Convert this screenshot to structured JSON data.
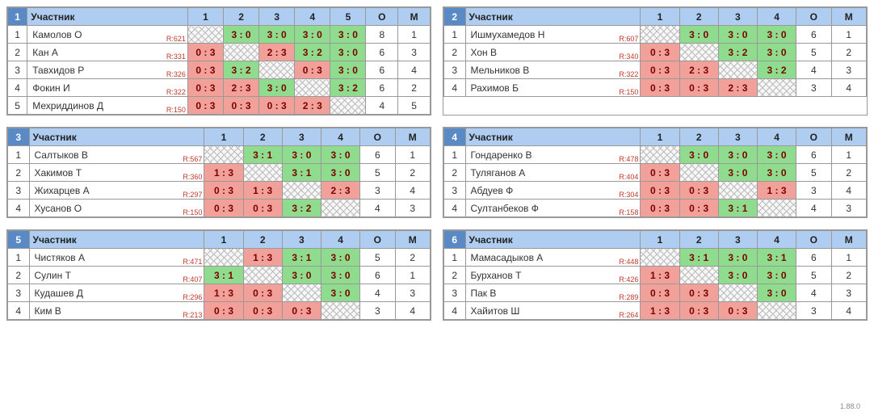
{
  "header_labels": {
    "participant": "Участник",
    "O": "О",
    "M": "М"
  },
  "version": "1.88.0",
  "chart_data": [
    {
      "group": 1,
      "rounds": 5,
      "players": [
        {
          "idx": 1,
          "name": "Камолов О",
          "rating": 621,
          "scores": [
            null,
            "3 : 0",
            "3 : 0",
            "3 : 0",
            "3 : 0"
          ],
          "results": [
            null,
            "win",
            "win",
            "win",
            "win"
          ],
          "O": 8,
          "M": 1
        },
        {
          "idx": 2,
          "name": "Кан А",
          "rating": 331,
          "scores": [
            "0 : 3",
            null,
            "2 : 3",
            "3 : 2",
            "3 : 0"
          ],
          "results": [
            "loss",
            null,
            "loss",
            "win",
            "win"
          ],
          "O": 6,
          "M": 3
        },
        {
          "idx": 3,
          "name": "Тавхидов Р",
          "rating": 326,
          "scores": [
            "0 : 3",
            "3 : 2",
            null,
            "0 : 3",
            "3 : 0"
          ],
          "results": [
            "loss",
            "win",
            null,
            "loss",
            "win"
          ],
          "O": 6,
          "M": 4
        },
        {
          "idx": 4,
          "name": "Фокин И",
          "rating": 322,
          "scores": [
            "0 : 3",
            "2 : 3",
            "3 : 0",
            null,
            "3 : 2"
          ],
          "results": [
            "loss",
            "loss",
            "win",
            null,
            "win"
          ],
          "O": 6,
          "M": 2
        },
        {
          "idx": 5,
          "name": "Мехриддинов Д",
          "rating": 150,
          "scores": [
            "0 : 3",
            "0 : 3",
            "0 : 3",
            "2 : 3",
            null
          ],
          "results": [
            "loss",
            "loss",
            "loss",
            "loss",
            null
          ],
          "O": 4,
          "M": 5
        }
      ]
    },
    {
      "group": 2,
      "rounds": 4,
      "players": [
        {
          "idx": 1,
          "name": "Ишмухамедов Н",
          "rating": 607,
          "scores": [
            null,
            "3 : 0",
            "3 : 0",
            "3 : 0"
          ],
          "results": [
            null,
            "win",
            "win",
            "win"
          ],
          "O": 6,
          "M": 1
        },
        {
          "idx": 2,
          "name": "Хон В",
          "rating": 340,
          "scores": [
            "0 : 3",
            null,
            "3 : 2",
            "3 : 0"
          ],
          "results": [
            "loss",
            null,
            "win",
            "win"
          ],
          "O": 5,
          "M": 2
        },
        {
          "idx": 3,
          "name": "Мельников В",
          "rating": 322,
          "scores": [
            "0 : 3",
            "2 : 3",
            null,
            "3 : 2"
          ],
          "results": [
            "loss",
            "loss",
            null,
            "win"
          ],
          "O": 4,
          "M": 3
        },
        {
          "idx": 4,
          "name": "Рахимов Б",
          "rating": 150,
          "scores": [
            "0 : 3",
            "0 : 3",
            "2 : 3",
            null
          ],
          "results": [
            "loss",
            "loss",
            "loss",
            null
          ],
          "O": 3,
          "M": 4
        }
      ]
    },
    {
      "group": 3,
      "rounds": 4,
      "players": [
        {
          "idx": 1,
          "name": "Салтыков В",
          "rating": 567,
          "scores": [
            null,
            "3 : 1",
            "3 : 0",
            "3 : 0"
          ],
          "results": [
            null,
            "win",
            "win",
            "win"
          ],
          "O": 6,
          "M": 1
        },
        {
          "idx": 2,
          "name": "Хакимов Т",
          "rating": 360,
          "scores": [
            "1 : 3",
            null,
            "3 : 1",
            "3 : 0"
          ],
          "results": [
            "loss",
            null,
            "win",
            "win"
          ],
          "O": 5,
          "M": 2
        },
        {
          "idx": 3,
          "name": "Жихарцев А",
          "rating": 297,
          "scores": [
            "0 : 3",
            "1 : 3",
            null,
            "2 : 3"
          ],
          "results": [
            "loss",
            "loss",
            null,
            "loss"
          ],
          "O": 3,
          "M": 4
        },
        {
          "idx": 4,
          "name": "Хусанов О",
          "rating": 150,
          "scores": [
            "0 : 3",
            "0 : 3",
            "3 : 2",
            null
          ],
          "results": [
            "loss",
            "loss",
            "win",
            null
          ],
          "O": 4,
          "M": 3
        }
      ]
    },
    {
      "group": 4,
      "rounds": 4,
      "players": [
        {
          "idx": 1,
          "name": "Гондаренко В",
          "rating": 478,
          "scores": [
            null,
            "3 : 0",
            "3 : 0",
            "3 : 0"
          ],
          "results": [
            null,
            "win",
            "win",
            "win"
          ],
          "O": 6,
          "M": 1
        },
        {
          "idx": 2,
          "name": "Туляганов А",
          "rating": 404,
          "scores": [
            "0 : 3",
            null,
            "3 : 0",
            "3 : 0"
          ],
          "results": [
            "loss",
            null,
            "win",
            "win"
          ],
          "O": 5,
          "M": 2
        },
        {
          "idx": 3,
          "name": "Абдуев Ф",
          "rating": 304,
          "scores": [
            "0 : 3",
            "0 : 3",
            null,
            "1 : 3"
          ],
          "results": [
            "loss",
            "loss",
            null,
            "loss"
          ],
          "O": 3,
          "M": 4
        },
        {
          "idx": 4,
          "name": "Султанбеков Ф",
          "rating": 158,
          "scores": [
            "0 : 3",
            "0 : 3",
            "3 : 1",
            null
          ],
          "results": [
            "loss",
            "loss",
            "win",
            null
          ],
          "O": 4,
          "M": 3
        }
      ]
    },
    {
      "group": 5,
      "rounds": 4,
      "players": [
        {
          "idx": 1,
          "name": "Чистяков А",
          "rating": 471,
          "scores": [
            null,
            "1 : 3",
            "3 : 1",
            "3 : 0"
          ],
          "results": [
            null,
            "loss",
            "win",
            "win"
          ],
          "O": 5,
          "M": 2
        },
        {
          "idx": 2,
          "name": "Сулин Т",
          "rating": 407,
          "scores": [
            "3 : 1",
            null,
            "3 : 0",
            "3 : 0"
          ],
          "results": [
            "win",
            null,
            "win",
            "win"
          ],
          "O": 6,
          "M": 1
        },
        {
          "idx": 3,
          "name": "Кудашев Д",
          "rating": 296,
          "scores": [
            "1 : 3",
            "0 : 3",
            null,
            "3 : 0"
          ],
          "results": [
            "loss",
            "loss",
            null,
            "win"
          ],
          "O": 4,
          "M": 3
        },
        {
          "idx": 4,
          "name": "Ким В",
          "rating": 213,
          "scores": [
            "0 : 3",
            "0 : 3",
            "0 : 3",
            null
          ],
          "results": [
            "loss",
            "loss",
            "loss",
            null
          ],
          "O": 3,
          "M": 4
        }
      ]
    },
    {
      "group": 6,
      "rounds": 4,
      "players": [
        {
          "idx": 1,
          "name": "Мамасадыков А",
          "rating": 448,
          "scores": [
            null,
            "3 : 1",
            "3 : 0",
            "3 : 1"
          ],
          "results": [
            null,
            "win",
            "win",
            "win"
          ],
          "O": 6,
          "M": 1
        },
        {
          "idx": 2,
          "name": "Бурханов Т",
          "rating": 426,
          "scores": [
            "1 : 3",
            null,
            "3 : 0",
            "3 : 0"
          ],
          "results": [
            "loss",
            null,
            "win",
            "win"
          ],
          "O": 5,
          "M": 2
        },
        {
          "idx": 3,
          "name": "Пак В",
          "rating": 289,
          "scores": [
            "0 : 3",
            "0 : 3",
            null,
            "3 : 0"
          ],
          "results": [
            "loss",
            "loss",
            null,
            "win"
          ],
          "O": 4,
          "M": 3
        },
        {
          "idx": 4,
          "name": "Хайитов Ш",
          "rating": 264,
          "scores": [
            "1 : 3",
            "0 : 3",
            "0 : 3",
            null
          ],
          "results": [
            "loss",
            "loss",
            "loss",
            null
          ],
          "O": 3,
          "M": 4
        }
      ]
    }
  ]
}
